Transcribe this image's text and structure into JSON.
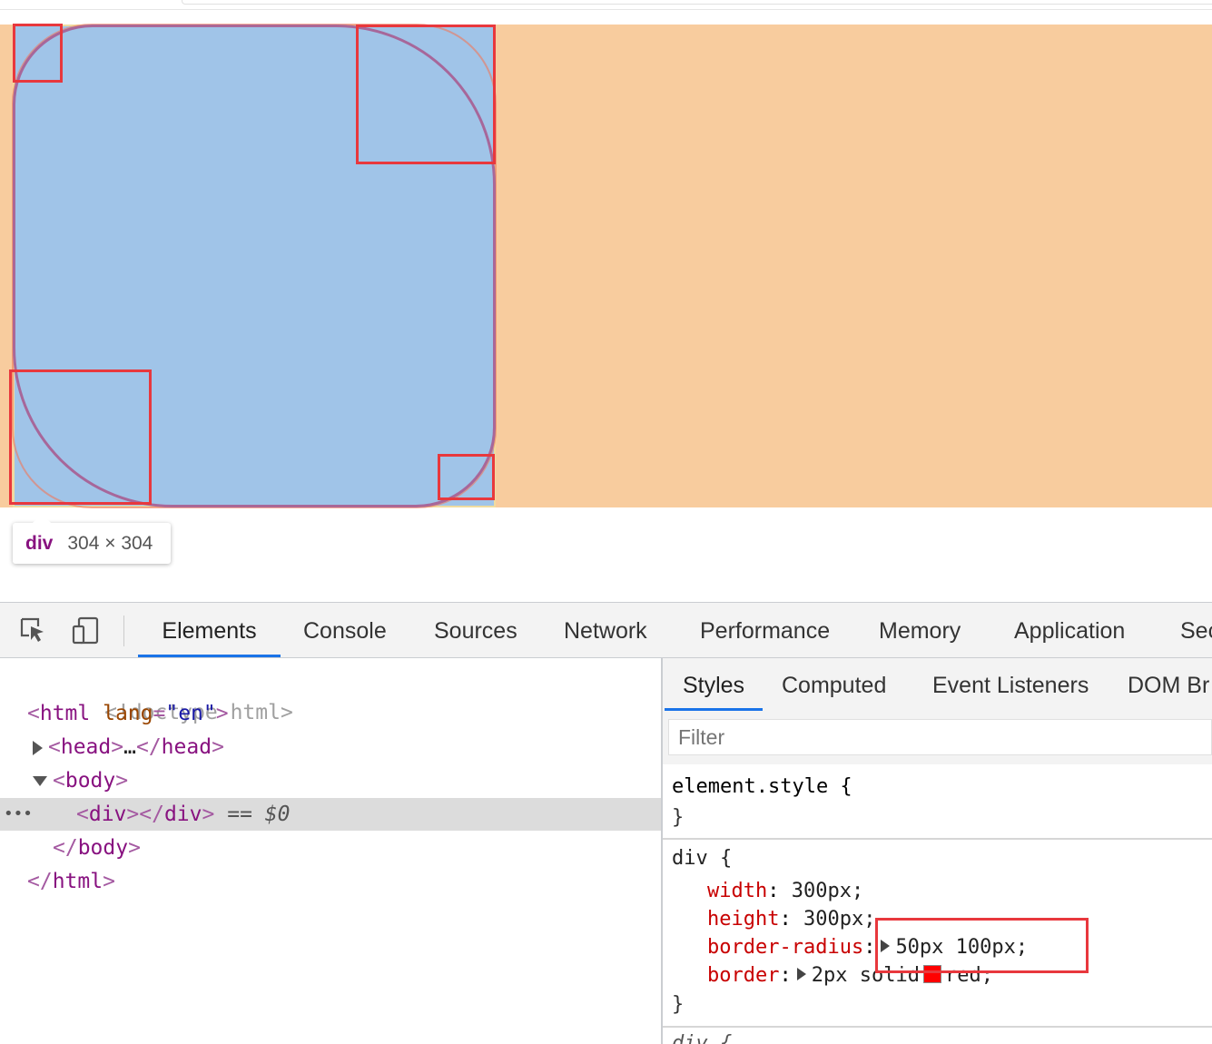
{
  "tooltip": {
    "tag": "div",
    "size": "304 × 304"
  },
  "devtools": {
    "tabs": [
      "Elements",
      "Console",
      "Sources",
      "Network",
      "Performance",
      "Memory",
      "Application",
      "Sec"
    ],
    "active_tab": "Elements",
    "dom": {
      "doctype": "<!doctype html>",
      "html_tag": "html",
      "html_attr": "lang",
      "html_attr_value": "\"en\"",
      "head_tag": "head",
      "ellipsis": "…",
      "body_tag": "body",
      "div_tag": "div",
      "selected_marker": "== $0",
      "dots": "•••"
    },
    "styles_tabs": [
      "Styles",
      "Computed",
      "Event Listeners",
      "DOM Br"
    ],
    "filter_placeholder": "Filter",
    "rules": {
      "element_style": "element.style {",
      "close": "}",
      "div_selector": "div {",
      "width_prop": "width",
      "width_val": "300px;",
      "height_prop": "height",
      "height_val": "300px;",
      "radius_prop": "border-radius",
      "radius_val": "50px 100px;",
      "border_prop": "border",
      "border_val_1": "2px solid",
      "border_val_2": "red;",
      "next_selector": "div {"
    }
  },
  "colors": {
    "margin_overlay": "#f8cc9e",
    "content_overlay": "#a0c4e8",
    "highlight_box": "#e8383d",
    "border_color": "#ff0000"
  }
}
